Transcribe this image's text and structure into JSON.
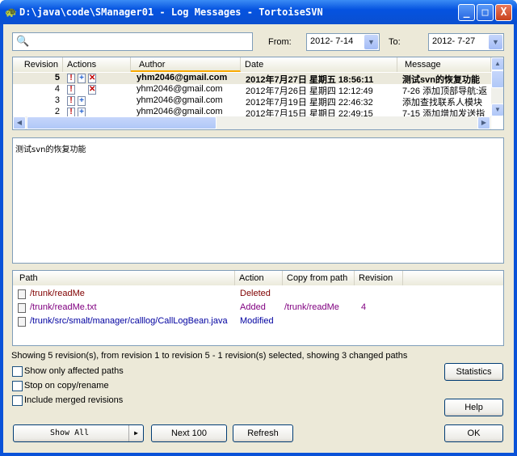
{
  "window": {
    "title": "D:\\java\\code\\SManager01 - Log Messages - TortoiseSVN",
    "min": "_",
    "max": "□",
    "close": "X"
  },
  "filter": {
    "search_value": "",
    "from_label": "From:",
    "from_value": "2012- 7-14",
    "to_label": "To:",
    "to_value": "2012- 7-27"
  },
  "log": {
    "columns": [
      "Revision",
      "Actions",
      "Author",
      "Date",
      "Message"
    ],
    "rows": [
      {
        "revision": "5",
        "actions": [
          "modified",
          "added",
          "deleted"
        ],
        "author": "yhm2046@gmail.com",
        "date": "2012年7月27日 星期五 18:56:11",
        "message": "测试svn的恢复功能",
        "selected": true
      },
      {
        "revision": "4",
        "actions": [
          "modified",
          "deleted"
        ],
        "author": "yhm2046@gmail.com",
        "date": "2012年7月26日 星期四 12:12:49",
        "message": "7-26 添加顶部导航:返"
      },
      {
        "revision": "3",
        "actions": [
          "modified",
          "added"
        ],
        "author": "yhm2046@gmail.com",
        "date": "2012年7月19日 星期四 22:46:32",
        "message": "添加查找联系人模块"
      },
      {
        "revision": "2",
        "actions": [
          "modified",
          "added"
        ],
        "author": "yhm2046@gmail.com",
        "date": "2012年7月15日 星期日 22:49:15",
        "message": "7-15 添加增加发送指"
      }
    ]
  },
  "message_text": "测试svn的恢复功能",
  "paths": {
    "columns": [
      "Path",
      "Action",
      "Copy from path",
      "Revision"
    ],
    "rows": [
      {
        "path": "/trunk/readMe",
        "action": "Deleted",
        "copy_from": "",
        "revision": "",
        "color": "#800000"
      },
      {
        "path": "/trunk/readMe.txt",
        "action": "Added",
        "copy_from": "/trunk/readMe",
        "revision": "4",
        "color": "#800080"
      },
      {
        "path": "/trunk/src/smalt/manager/calllog/CallLogBean.java",
        "action": "Modified",
        "copy_from": "",
        "revision": "",
        "color": "#0000a0"
      }
    ]
  },
  "status": "Showing 5 revision(s), from revision 1 to revision 5 - 1 revision(s) selected, showing 3 changed paths",
  "options": {
    "affected": "Show only affected paths",
    "stop": "Stop on copy/rename",
    "merged": "Include merged revisions"
  },
  "buttons": {
    "statistics": "Statistics",
    "help": "Help",
    "show_all": "Show All",
    "next": "Next 100",
    "refresh": "Refresh",
    "ok": "OK"
  }
}
